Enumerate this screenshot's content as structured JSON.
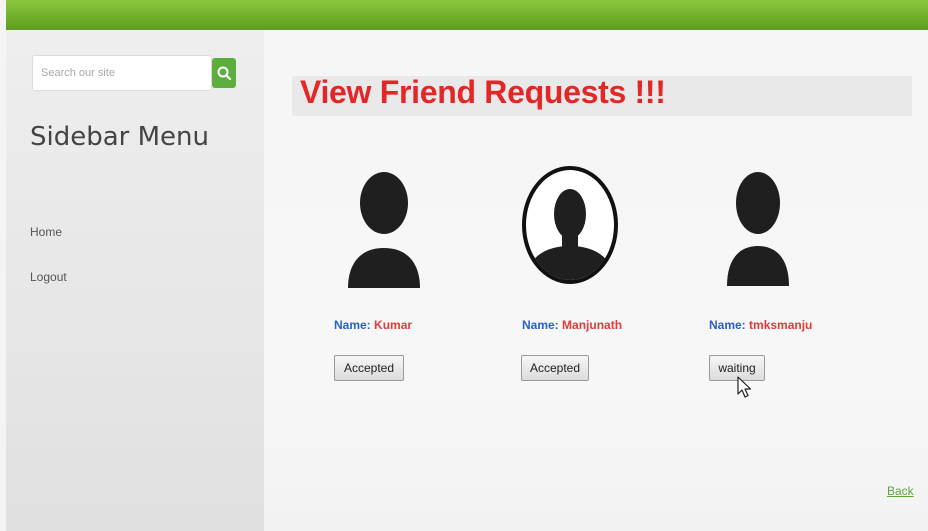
{
  "search": {
    "placeholder": "Search our site"
  },
  "sidebar": {
    "title": "Sidebar Menu",
    "items": [
      {
        "label": "Home",
        "icon": "none"
      },
      {
        "label": "Logout",
        "icon": "none"
      }
    ]
  },
  "main": {
    "heading": "View Friend Requests !!!",
    "name_label": "Name:",
    "friends": [
      {
        "name": "Kumar",
        "status": "Accepted",
        "avatar": "person-silhouette-icon"
      },
      {
        "name": "Manjunath",
        "status": "Accepted",
        "avatar": "person-circle-silhouette-icon"
      },
      {
        "name": "tmksmanju",
        "status": "waiting",
        "avatar": "person-silhouette-icon"
      }
    ],
    "back_label": "Back"
  },
  "colors": {
    "top_bar": "#6fae2a",
    "heading": "#e32626",
    "name_label": "#2a5fcc",
    "name_value": "#e03a3a",
    "search_button": "#5cae3e",
    "back_link": "#5aa83a"
  }
}
